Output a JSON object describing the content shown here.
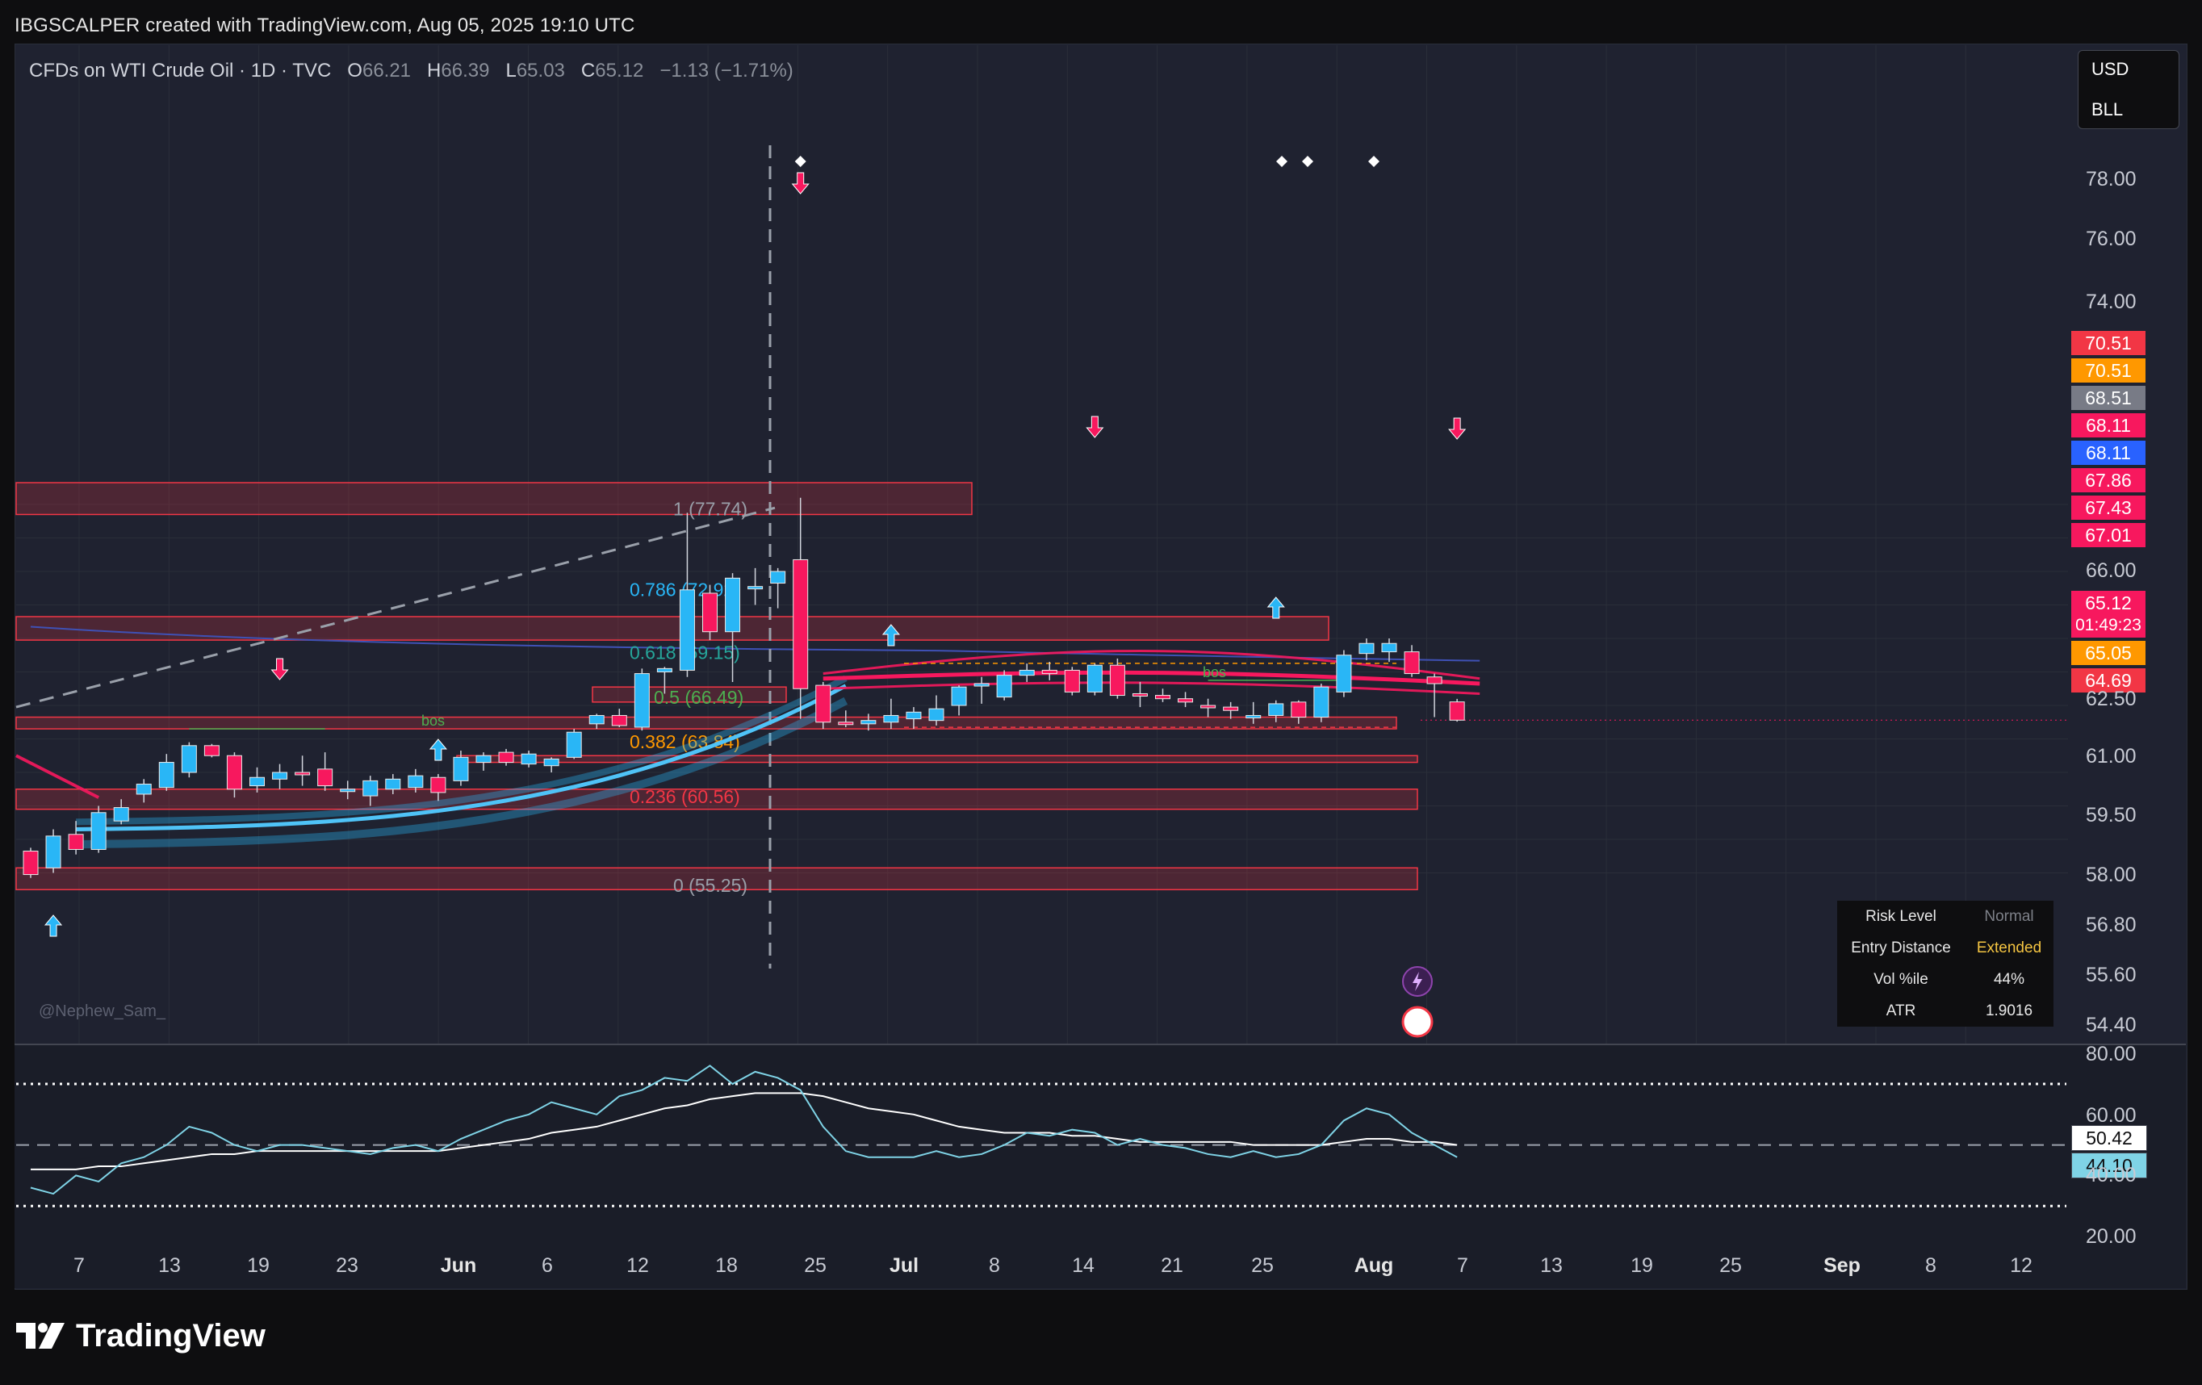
{
  "header": "IBGSCALPER created with TradingView.com, Aug 05, 2025 19:10 UTC",
  "legend": {
    "symbol": "CFDs on WTI Crude Oil · 1D · TVC",
    "open_label": "O",
    "open": "66.21",
    "high_label": "H",
    "high": "66.39",
    "low_label": "L",
    "low": "65.03",
    "close_label": "C",
    "close": "65.12",
    "change": "−1.13 (−1.71%)"
  },
  "currency_box": {
    "currency": "USD",
    "unit": "BLL"
  },
  "watermark": "@Nephew_Sam_",
  "risk_table": [
    {
      "key": "Risk Level",
      "value": "Normal",
      "color": "#7d8088"
    },
    {
      "key": "Entry Distance",
      "value": "Extended",
      "color": "#f5c542"
    },
    {
      "key": "Vol %ile",
      "value": "44%",
      "color": "#e8e8e8"
    },
    {
      "key": "ATR",
      "value": "1.9016",
      "color": "#e8e8e8"
    }
  ],
  "brand": "TradingView",
  "price_tags": [
    {
      "text": "70.51",
      "color": "#f23645"
    },
    {
      "text": "70.51",
      "color": "#ff9800"
    },
    {
      "text": "68.51",
      "color": "#787b86"
    },
    {
      "text": "68.11",
      "color": "#f7185e"
    },
    {
      "text": "68.11",
      "color": "#2962ff"
    },
    {
      "text": "67.86",
      "color": "#f7185e"
    },
    {
      "text": "67.43",
      "color": "#f7185e"
    },
    {
      "text": "67.01",
      "color": "#f7185e"
    },
    {
      "text": "65.12",
      "color": "#f7185e"
    },
    {
      "text": "01:49:23",
      "color": "#f7185e"
    },
    {
      "text": "65.05",
      "color": "#ff9800"
    },
    {
      "text": "64.69",
      "color": "#f23645"
    }
  ],
  "rsi_tags": [
    {
      "text": "50.42",
      "color": "#ffffff"
    },
    {
      "text": "44.10",
      "color": "#7fd3e6"
    }
  ],
  "colors": {
    "bull": "#29b6f6",
    "bear": "#f7185e",
    "background": "#1f2230",
    "fib_line": "#9aa0aa"
  },
  "chart_data": {
    "type": "candlestick",
    "title": "CFDs on WTI Crude Oil · 1D · TVC",
    "ohlc_current": {
      "open": 66.21,
      "high": 66.39,
      "low": 65.03,
      "close": 65.12,
      "change": -1.13,
      "change_pct": -1.71
    },
    "y_ticks": [
      "78.00",
      "76.00",
      "74.00",
      "66.00",
      "62.50",
      "61.00",
      "59.50",
      "58.00",
      "56.80",
      "55.60",
      "54.40"
    ],
    "x_ticks": [
      {
        "label": "7",
        "bold": false
      },
      {
        "label": "13",
        "bold": false
      },
      {
        "label": "19",
        "bold": false
      },
      {
        "label": "23",
        "bold": false
      },
      {
        "label": "Jun",
        "bold": true
      },
      {
        "label": "6",
        "bold": false
      },
      {
        "label": "12",
        "bold": false
      },
      {
        "label": "18",
        "bold": false
      },
      {
        "label": "25",
        "bold": false
      },
      {
        "label": "Jul",
        "bold": true
      },
      {
        "label": "8",
        "bold": false
      },
      {
        "label": "14",
        "bold": false
      },
      {
        "label": "21",
        "bold": false
      },
      {
        "label": "25",
        "bold": false
      },
      {
        "label": "Aug",
        "bold": true
      },
      {
        "label": "7",
        "bold": false
      },
      {
        "label": "13",
        "bold": false
      },
      {
        "label": "19",
        "bold": false
      },
      {
        "label": "25",
        "bold": false
      },
      {
        "label": "Sep",
        "bold": true
      },
      {
        "label": "8",
        "bold": false
      },
      {
        "label": "12",
        "bold": false
      }
    ],
    "candles": [
      {
        "o": 57.3,
        "h": 57.5,
        "l": 55.7,
        "c": 55.9
      },
      {
        "o": 56.3,
        "h": 58.6,
        "l": 56.0,
        "c": 58.2
      },
      {
        "o": 58.3,
        "h": 59.1,
        "l": 57.1,
        "c": 57.4
      },
      {
        "o": 57.4,
        "h": 60.0,
        "l": 57.2,
        "c": 59.6
      },
      {
        "o": 59.1,
        "h": 60.4,
        "l": 58.9,
        "c": 59.9
      },
      {
        "o": 60.7,
        "h": 61.6,
        "l": 60.2,
        "c": 61.3
      },
      {
        "o": 61.1,
        "h": 63.1,
        "l": 60.9,
        "c": 62.6
      },
      {
        "o": 62.0,
        "h": 63.8,
        "l": 61.7,
        "c": 63.6
      },
      {
        "o": 63.6,
        "h": 63.7,
        "l": 62.9,
        "c": 63.0
      },
      {
        "o": 63.0,
        "h": 63.2,
        "l": 60.5,
        "c": 61.0
      },
      {
        "o": 61.2,
        "h": 62.3,
        "l": 60.8,
        "c": 61.7
      },
      {
        "o": 61.6,
        "h": 62.5,
        "l": 61.0,
        "c": 62.0
      },
      {
        "o": 62.0,
        "h": 63.0,
        "l": 61.2,
        "c": 61.9
      },
      {
        "o": 62.2,
        "h": 63.2,
        "l": 60.9,
        "c": 61.2
      },
      {
        "o": 60.9,
        "h": 61.5,
        "l": 60.4,
        "c": 61.0
      },
      {
        "o": 60.6,
        "h": 61.8,
        "l": 60.0,
        "c": 61.5
      },
      {
        "o": 61.0,
        "h": 61.9,
        "l": 60.7,
        "c": 61.6
      },
      {
        "o": 61.1,
        "h": 62.2,
        "l": 60.8,
        "c": 61.8
      },
      {
        "o": 61.7,
        "h": 61.9,
        "l": 60.3,
        "c": 60.8
      },
      {
        "o": 61.5,
        "h": 63.3,
        "l": 61.2,
        "c": 62.9
      },
      {
        "o": 62.6,
        "h": 63.2,
        "l": 62.1,
        "c": 63.0
      },
      {
        "o": 63.2,
        "h": 63.4,
        "l": 62.4,
        "c": 62.6
      },
      {
        "o": 62.5,
        "h": 63.3,
        "l": 62.3,
        "c": 63.1
      },
      {
        "o": 62.4,
        "h": 62.9,
        "l": 62.0,
        "c": 62.8
      },
      {
        "o": 62.9,
        "h": 64.6,
        "l": 62.8,
        "c": 64.4
      },
      {
        "o": 64.9,
        "h": 65.5,
        "l": 64.6,
        "c": 65.4
      },
      {
        "o": 65.4,
        "h": 65.8,
        "l": 64.7,
        "c": 64.8
      },
      {
        "o": 64.7,
        "h": 68.2,
        "l": 64.5,
        "c": 67.9
      },
      {
        "o": 68.0,
        "h": 68.3,
        "l": 66.7,
        "c": 68.2
      },
      {
        "o": 68.1,
        "h": 77.5,
        "l": 67.7,
        "c": 72.9
      },
      {
        "o": 72.7,
        "h": 73.2,
        "l": 69.9,
        "c": 70.4
      },
      {
        "o": 70.4,
        "h": 73.9,
        "l": 67.4,
        "c": 73.6
      },
      {
        "o": 73.0,
        "h": 74.2,
        "l": 72.0,
        "c": 73.1
      },
      {
        "o": 73.3,
        "h": 74.2,
        "l": 71.8,
        "c": 74.0
      },
      {
        "o": 74.7,
        "h": 78.4,
        "l": 65.2,
        "c": 67.0
      },
      {
        "o": 67.2,
        "h": 67.4,
        "l": 64.6,
        "c": 65.0
      },
      {
        "o": 65.0,
        "h": 65.7,
        "l": 64.7,
        "c": 64.9
      },
      {
        "o": 64.9,
        "h": 65.5,
        "l": 64.5,
        "c": 65.1
      },
      {
        "o": 65.0,
        "h": 66.4,
        "l": 64.6,
        "c": 65.4
      },
      {
        "o": 65.2,
        "h": 65.9,
        "l": 64.6,
        "c": 65.6
      },
      {
        "o": 65.1,
        "h": 66.6,
        "l": 64.8,
        "c": 65.8
      },
      {
        "o": 66.0,
        "h": 67.2,
        "l": 65.4,
        "c": 67.1
      },
      {
        "o": 67.2,
        "h": 67.7,
        "l": 66.1,
        "c": 67.3
      },
      {
        "o": 66.5,
        "h": 68.1,
        "l": 66.3,
        "c": 67.8
      },
      {
        "o": 67.8,
        "h": 68.5,
        "l": 67.4,
        "c": 68.1
      },
      {
        "o": 68.1,
        "h": 68.6,
        "l": 67.5,
        "c": 67.9
      },
      {
        "o": 68.1,
        "h": 68.3,
        "l": 66.6,
        "c": 66.8
      },
      {
        "o": 66.8,
        "h": 68.5,
        "l": 66.6,
        "c": 68.4
      },
      {
        "o": 68.4,
        "h": 68.8,
        "l": 66.4,
        "c": 66.6
      },
      {
        "o": 66.7,
        "h": 67.4,
        "l": 65.9,
        "c": 66.6
      },
      {
        "o": 66.6,
        "h": 67.0,
        "l": 66.2,
        "c": 66.4
      },
      {
        "o": 66.4,
        "h": 66.8,
        "l": 65.9,
        "c": 66.2
      },
      {
        "o": 66.0,
        "h": 66.4,
        "l": 65.3,
        "c": 65.9
      },
      {
        "o": 65.9,
        "h": 66.2,
        "l": 65.2,
        "c": 65.7
      },
      {
        "o": 65.3,
        "h": 66.2,
        "l": 64.9,
        "c": 65.4
      },
      {
        "o": 65.4,
        "h": 66.3,
        "l": 65.0,
        "c": 66.1
      },
      {
        "o": 66.2,
        "h": 66.3,
        "l": 64.9,
        "c": 65.3
      },
      {
        "o": 65.3,
        "h": 67.3,
        "l": 65.0,
        "c": 67.1
      },
      {
        "o": 66.8,
        "h": 69.3,
        "l": 66.5,
        "c": 69.0
      },
      {
        "o": 69.1,
        "h": 70.0,
        "l": 68.7,
        "c": 69.7
      },
      {
        "o": 69.2,
        "h": 70.0,
        "l": 68.6,
        "c": 69.7
      },
      {
        "o": 69.2,
        "h": 69.6,
        "l": 67.7,
        "c": 67.9
      },
      {
        "o": 67.7,
        "h": 67.9,
        "l": 65.3,
        "c": 67.3
      },
      {
        "o": 66.21,
        "h": 66.39,
        "l": 65.03,
        "c": 65.12
      }
    ],
    "fib_levels": [
      {
        "ratio": "1",
        "value": 77.74,
        "label": "1 (77.74)",
        "color": "#9aa0aa"
      },
      {
        "ratio": "0.786",
        "value": 72.92,
        "label": "0.786 (72.92)",
        "color": "#29b6f6"
      },
      {
        "ratio": "0.618",
        "value": 69.15,
        "label": "0.618 (69.15)",
        "color": "#26a69a"
      },
      {
        "ratio": "0.5",
        "value": 66.49,
        "label": "0.5 (66.49)",
        "color": "#4caf50"
      },
      {
        "ratio": "0.382",
        "value": 63.84,
        "label": "0.382 (63.84)",
        "color": "#ff9800"
      },
      {
        "ratio": "0.236",
        "value": 60.56,
        "label": "0.236 (60.56)",
        "color": "#f23645"
      },
      {
        "ratio": "0",
        "value": 55.25,
        "label": "0 (55.25)",
        "color": "#9aa0aa"
      }
    ],
    "annotations": [
      "bos",
      "bos"
    ],
    "rsi": {
      "y_ticks": [
        "80.00",
        "60.00",
        "40.00",
        "20.00"
      ],
      "overbought": 70,
      "oversold": 30,
      "mid": 50,
      "rsi_value": 44.1,
      "signal_value": 50.42
    }
  }
}
